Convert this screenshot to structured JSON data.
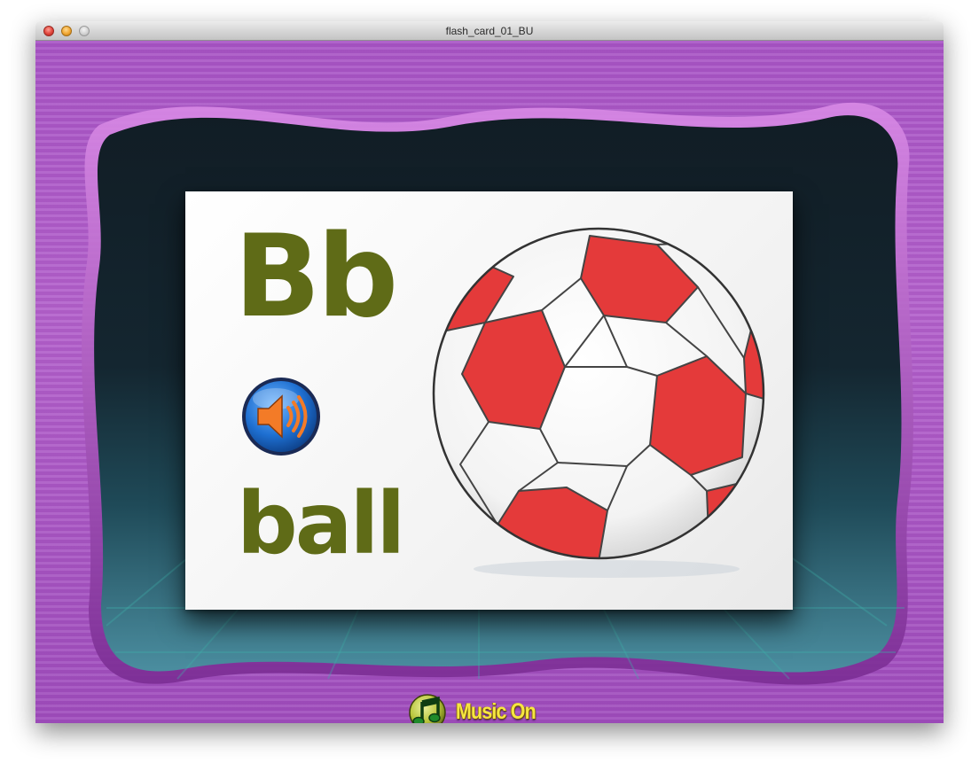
{
  "window": {
    "title": "flash_card_01_BU"
  },
  "flash_card": {
    "letter": "Bb",
    "word": "ball",
    "picture_icon": "soccer-ball-icon",
    "speaker_icon": "speaker-sound-icon"
  },
  "music_toggle": {
    "label": "Music On",
    "icon": "music-note-icon"
  },
  "colors": {
    "letter_text": "#5f6b17",
    "frame_purple": "#a957c6",
    "speaker_blue": "#1e6fd1",
    "music_label": "#f6e640"
  }
}
